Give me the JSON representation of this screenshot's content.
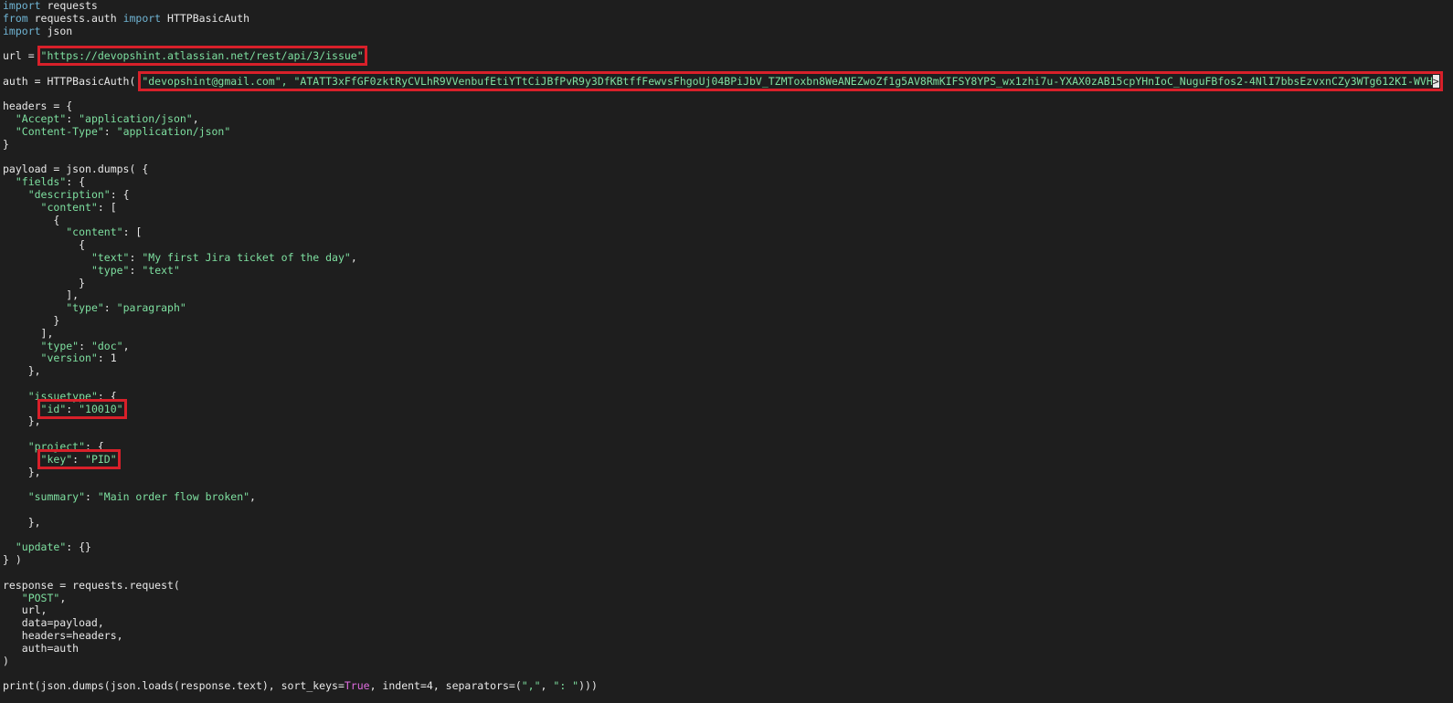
{
  "code": {
    "lines": [
      {
        "tokens": [
          {
            "t": "import",
            "c": "kw"
          },
          {
            "t": " requests",
            "c": "txt"
          }
        ]
      },
      {
        "tokens": [
          {
            "t": "from",
            "c": "kw"
          },
          {
            "t": " requests.auth ",
            "c": "txt"
          },
          {
            "t": "import",
            "c": "kw"
          },
          {
            "t": " HTTPBasicAuth",
            "c": "txt"
          }
        ]
      },
      {
        "tokens": [
          {
            "t": "import",
            "c": "kw"
          },
          {
            "t": " json",
            "c": "txt"
          }
        ]
      },
      {
        "tokens": []
      },
      {
        "tokens": [
          {
            "t": "url = ",
            "c": "txt"
          },
          {
            "t": "\"https://devopshint.atlassian.net/rest/api/3/issue\"",
            "c": "str",
            "hl": true
          }
        ]
      },
      {
        "tokens": []
      },
      {
        "tokens": [
          {
            "t": "auth = HTTPBasicAuth( ",
            "c": "txt"
          },
          {
            "t": "\"devopshint@gmail.com\", \"ATATT3xFfGF0zktRyCVLhR9VVenbufEtiYTtCiJBfPvR9y3DfKBtffFewvsFhgoUj04BPiJbV_TZMToxbn8WeANEZwoZf1g5AV8RmKIFSY8YPS_wx1zhi7u-YXAX0zAB15cpYHnIoC_NuguFBfos2-4NlI7bbsEzvxnCZy3WTg612KI-WVH",
            "c": "str",
            "hl": true,
            "cursor": ">"
          }
        ]
      },
      {
        "tokens": []
      },
      {
        "tokens": [
          {
            "t": "headers = {",
            "c": "txt"
          }
        ]
      },
      {
        "tokens": [
          {
            "t": "  ",
            "c": "txt"
          },
          {
            "t": "\"Accept\"",
            "c": "str"
          },
          {
            "t": ": ",
            "c": "txt"
          },
          {
            "t": "\"application/json\"",
            "c": "str"
          },
          {
            "t": ",",
            "c": "txt"
          }
        ]
      },
      {
        "tokens": [
          {
            "t": "  ",
            "c": "txt"
          },
          {
            "t": "\"Content-Type\"",
            "c": "str"
          },
          {
            "t": ": ",
            "c": "txt"
          },
          {
            "t": "\"application/json\"",
            "c": "str"
          }
        ]
      },
      {
        "tokens": [
          {
            "t": "}",
            "c": "txt"
          }
        ]
      },
      {
        "tokens": []
      },
      {
        "tokens": [
          {
            "t": "payload = json.dumps( {",
            "c": "txt"
          }
        ]
      },
      {
        "tokens": [
          {
            "t": "  ",
            "c": "txt"
          },
          {
            "t": "\"fields\"",
            "c": "str"
          },
          {
            "t": ": {",
            "c": "txt"
          }
        ]
      },
      {
        "tokens": [
          {
            "t": "    ",
            "c": "txt"
          },
          {
            "t": "\"description\"",
            "c": "str"
          },
          {
            "t": ": {",
            "c": "txt"
          }
        ]
      },
      {
        "tokens": [
          {
            "t": "      ",
            "c": "txt"
          },
          {
            "t": "\"content\"",
            "c": "str"
          },
          {
            "t": ": [",
            "c": "txt"
          }
        ]
      },
      {
        "tokens": [
          {
            "t": "        {",
            "c": "txt"
          }
        ]
      },
      {
        "tokens": [
          {
            "t": "          ",
            "c": "txt"
          },
          {
            "t": "\"content\"",
            "c": "str"
          },
          {
            "t": ": [",
            "c": "txt"
          }
        ]
      },
      {
        "tokens": [
          {
            "t": "            {",
            "c": "txt"
          }
        ]
      },
      {
        "tokens": [
          {
            "t": "              ",
            "c": "txt"
          },
          {
            "t": "\"text\"",
            "c": "str"
          },
          {
            "t": ": ",
            "c": "txt"
          },
          {
            "t": "\"My first Jira ticket of the day\"",
            "c": "str"
          },
          {
            "t": ",",
            "c": "txt"
          }
        ]
      },
      {
        "tokens": [
          {
            "t": "              ",
            "c": "txt"
          },
          {
            "t": "\"type\"",
            "c": "str"
          },
          {
            "t": ": ",
            "c": "txt"
          },
          {
            "t": "\"text\"",
            "c": "str"
          }
        ]
      },
      {
        "tokens": [
          {
            "t": "            }",
            "c": "txt"
          }
        ]
      },
      {
        "tokens": [
          {
            "t": "          ],",
            "c": "txt"
          }
        ]
      },
      {
        "tokens": [
          {
            "t": "          ",
            "c": "txt"
          },
          {
            "t": "\"type\"",
            "c": "str"
          },
          {
            "t": ": ",
            "c": "txt"
          },
          {
            "t": "\"paragraph\"",
            "c": "str"
          }
        ]
      },
      {
        "tokens": [
          {
            "t": "        }",
            "c": "txt"
          }
        ]
      },
      {
        "tokens": [
          {
            "t": "      ],",
            "c": "txt"
          }
        ]
      },
      {
        "tokens": [
          {
            "t": "      ",
            "c": "txt"
          },
          {
            "t": "\"type\"",
            "c": "str"
          },
          {
            "t": ": ",
            "c": "txt"
          },
          {
            "t": "\"doc\"",
            "c": "str"
          },
          {
            "t": ",",
            "c": "txt"
          }
        ]
      },
      {
        "tokens": [
          {
            "t": "      ",
            "c": "txt"
          },
          {
            "t": "\"version\"",
            "c": "str"
          },
          {
            "t": ": 1",
            "c": "txt"
          }
        ]
      },
      {
        "tokens": [
          {
            "t": "    },",
            "c": "txt"
          }
        ]
      },
      {
        "tokens": []
      },
      {
        "tokens": [
          {
            "t": "    ",
            "c": "txt"
          },
          {
            "t": "\"issuetype\"",
            "c": "str"
          },
          {
            "t": ": {",
            "c": "txt"
          }
        ]
      },
      {
        "tokens": [
          {
            "t": "      ",
            "c": "txt"
          },
          {
            "t": "\"id\"",
            "c": "str",
            "hl": true,
            "group": "a"
          },
          {
            "t": ": ",
            "c": "txt",
            "hl": true,
            "group": "a"
          },
          {
            "t": "\"10010\"",
            "c": "str",
            "hl": true,
            "group": "a"
          }
        ]
      },
      {
        "tokens": [
          {
            "t": "    },",
            "c": "txt"
          }
        ]
      },
      {
        "tokens": []
      },
      {
        "tokens": [
          {
            "t": "    ",
            "c": "txt"
          },
          {
            "t": "\"project\"",
            "c": "str"
          },
          {
            "t": ": {",
            "c": "txt"
          }
        ]
      },
      {
        "tokens": [
          {
            "t": "      ",
            "c": "txt"
          },
          {
            "t": "\"key\"",
            "c": "str",
            "hl": true,
            "group": "b"
          },
          {
            "t": ": ",
            "c": "txt",
            "hl": true,
            "group": "b"
          },
          {
            "t": "\"PID\"",
            "c": "str",
            "hl": true,
            "group": "b"
          }
        ]
      },
      {
        "tokens": [
          {
            "t": "    },",
            "c": "txt"
          }
        ]
      },
      {
        "tokens": []
      },
      {
        "tokens": [
          {
            "t": "    ",
            "c": "txt"
          },
          {
            "t": "\"summary\"",
            "c": "str"
          },
          {
            "t": ": ",
            "c": "txt"
          },
          {
            "t": "\"Main order flow broken\"",
            "c": "str"
          },
          {
            "t": ",",
            "c": "txt"
          }
        ]
      },
      {
        "tokens": []
      },
      {
        "tokens": [
          {
            "t": "    },",
            "c": "txt"
          }
        ]
      },
      {
        "tokens": []
      },
      {
        "tokens": [
          {
            "t": "  ",
            "c": "txt"
          },
          {
            "t": "\"update\"",
            "c": "str"
          },
          {
            "t": ": {}",
            "c": "txt"
          }
        ]
      },
      {
        "tokens": [
          {
            "t": "} )",
            "c": "txt"
          }
        ]
      },
      {
        "tokens": []
      },
      {
        "tokens": [
          {
            "t": "response = requests.request(",
            "c": "txt"
          }
        ]
      },
      {
        "tokens": [
          {
            "t": "   ",
            "c": "txt"
          },
          {
            "t": "\"POST\"",
            "c": "str"
          },
          {
            "t": ",",
            "c": "txt"
          }
        ]
      },
      {
        "tokens": [
          {
            "t": "   url,",
            "c": "txt"
          }
        ]
      },
      {
        "tokens": [
          {
            "t": "   data=payload,",
            "c": "txt"
          }
        ]
      },
      {
        "tokens": [
          {
            "t": "   headers=headers,",
            "c": "txt"
          }
        ]
      },
      {
        "tokens": [
          {
            "t": "   auth=auth",
            "c": "txt"
          }
        ]
      },
      {
        "tokens": [
          {
            "t": ")",
            "c": "txt"
          }
        ]
      },
      {
        "tokens": []
      },
      {
        "tokens": [
          {
            "t": "print(json.dumps(json.loads(response.text), sort_keys=",
            "c": "txt"
          },
          {
            "t": "True",
            "c": "true"
          },
          {
            "t": ", indent=4, separators=(",
            "c": "txt"
          },
          {
            "t": "\",\"",
            "c": "str"
          },
          {
            "t": ", ",
            "c": "txt"
          },
          {
            "t": "\": \"",
            "c": "str"
          },
          {
            "t": ")))",
            "c": "txt"
          }
        ]
      }
    ]
  },
  "colors": {
    "background": "#1e1e1e",
    "keyword": "#6fb3d2",
    "string": "#7ee0a0",
    "boolean": "#e06ce0",
    "highlight_box": "#d8202a"
  }
}
